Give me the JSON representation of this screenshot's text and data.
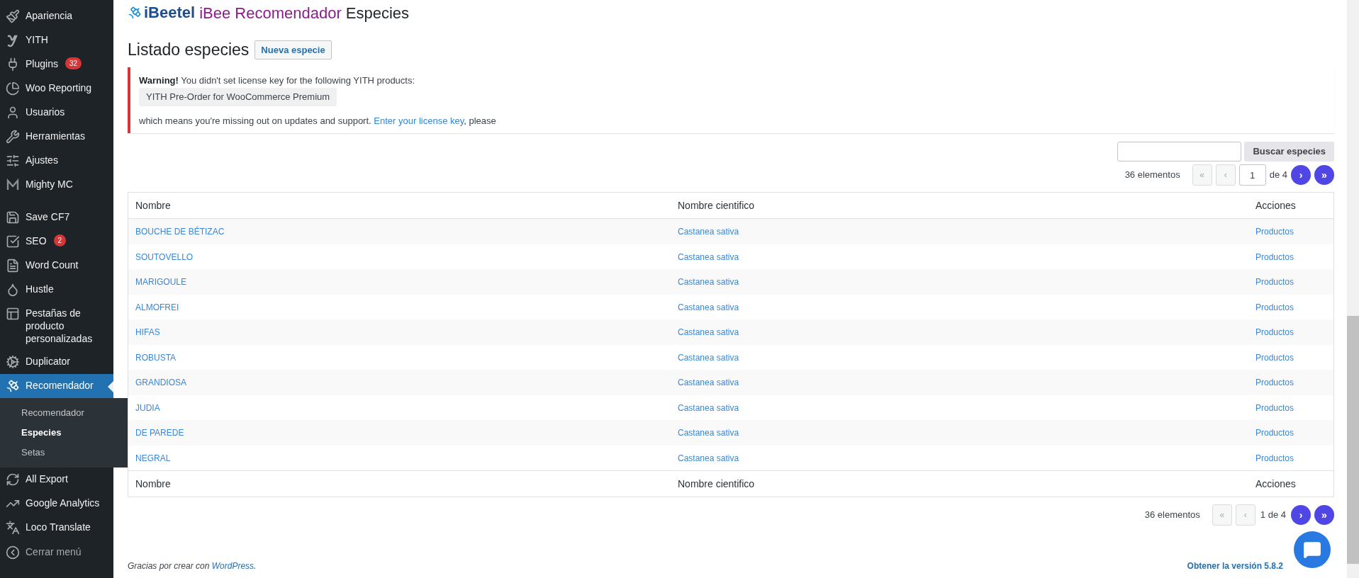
{
  "sidebar": {
    "groups": [
      {
        "items": [
          {
            "label": "Apariencia",
            "selected": false
          },
          {
            "label": "YITH",
            "selected": false
          },
          {
            "label": "Plugins",
            "badge": "32",
            "selected": false
          },
          {
            "label": "Woo Reporting",
            "selected": false
          },
          {
            "label": "Usuarios",
            "selected": false
          },
          {
            "label": "Herramientas",
            "selected": false
          },
          {
            "label": "Ajustes",
            "selected": false
          },
          {
            "label": "Mighty MC",
            "selected": false
          }
        ]
      },
      {
        "items": [
          {
            "label": "Save CF7",
            "selected": false
          },
          {
            "label": "SEO",
            "badge": "2",
            "selected": false
          },
          {
            "label": "Word Count",
            "selected": false
          },
          {
            "label": "Hustle",
            "selected": false
          },
          {
            "label": "Pestañas de producto personalizadas",
            "selected": false
          },
          {
            "label": "Duplicator",
            "selected": false
          },
          {
            "label": "Recomendador",
            "selected": true,
            "children": [
              {
                "label": "Recomendador",
                "selected": false
              },
              {
                "label": "Especies",
                "selected": true
              },
              {
                "label": "Setas",
                "selected": false
              }
            ]
          },
          {
            "label": "All Export",
            "selected": false
          },
          {
            "label": "Google Analytics",
            "selected": false
          },
          {
            "label": "Loco Translate",
            "selected": false
          }
        ]
      }
    ],
    "collapse_button": "Cerrar menú"
  },
  "header": {
    "logo_text": "iBeetel",
    "title": "iBee Recomendador",
    "subtitle": "Especies"
  },
  "page": {
    "title": "Listado especies",
    "new_button": "Nueva especie"
  },
  "notice": {
    "strong": "Warning!",
    "text": "You didn't set license key for the following YITH products:",
    "product": "YITH Pre-Order for WooCommerce Premium",
    "text_after": "which means you're missing out on updates and support.",
    "link": "Enter your license key",
    "text_end": ", please"
  },
  "search": {
    "button": "Buscar especies"
  },
  "pagination_top": {
    "count": "36 elementos",
    "buttons": [
      {
        "label": "«",
        "disabled": true
      },
      {
        "label": "‹",
        "disabled": true
      },
      {
        "label": "›",
        "disabled": false
      },
      {
        "label": "»",
        "disabled": false
      }
    ],
    "current": "1",
    "total": "de 4"
  },
  "table": {
    "columns": [
      "Nombre",
      "Nombre cientifico",
      "Acciones"
    ],
    "rows": [
      [
        "BOUCHE DE BÉTIZAC",
        "Castanea sativa",
        "Productos"
      ],
      [
        "SOUTOVELLO",
        "Castanea sativa",
        "Productos"
      ],
      [
        "MARIGOULE",
        "Castanea sativa",
        "Productos"
      ],
      [
        "ALMOFREI",
        "Castanea sativa",
        "Productos"
      ],
      [
        "HIFAS",
        "Castanea sativa",
        "Productos"
      ],
      [
        "ROBUSTA",
        "Castanea sativa",
        "Productos"
      ],
      [
        "GRANDIOSA",
        "Castanea sativa",
        "Productos"
      ],
      [
        "JUDIA",
        "Castanea sativa",
        "Productos"
      ],
      [
        "DE PAREDE",
        "Castanea sativa",
        "Productos"
      ],
      [
        "NEGRAL",
        "Castanea sativa",
        "Productos"
      ]
    ],
    "footer_columns": [
      "Nombre",
      "Nombre cientifico",
      "Acciones"
    ]
  },
  "pagination_bottom": {
    "count": "36 elementos",
    "buttons": [
      {
        "label": "«",
        "disabled": true
      },
      {
        "label": "‹",
        "disabled": true
      },
      {
        "label": "›",
        "disabled": false
      },
      {
        "label": "»",
        "disabled": false
      }
    ],
    "page_text": "1 de 4"
  },
  "footer": {
    "text": "Gracias por crear con",
    "link": "WordPress",
    "text_end": ".",
    "version": "Obtener la versión 5.8.2"
  }
}
